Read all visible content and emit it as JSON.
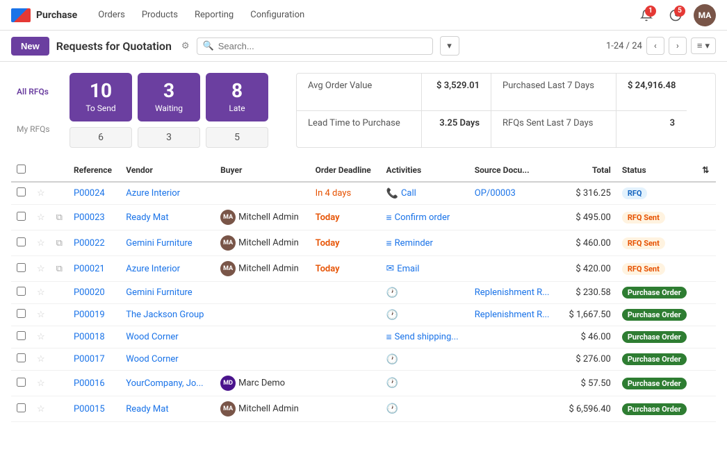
{
  "app": {
    "logo_text": "Purchase",
    "nav_items": [
      "Orders",
      "Products",
      "Reporting",
      "Configuration"
    ]
  },
  "topnav": {
    "notification_badge": "1",
    "activity_badge": "5",
    "avatar_initials": "MA"
  },
  "subheader": {
    "new_btn": "New",
    "title": "Requests for Quotation",
    "search_placeholder": "Search...",
    "pagination": "1-24 / 24"
  },
  "stats": {
    "all_rfqs_label": "All RFQs",
    "my_rfqs_label": "My RFQs",
    "cards": [
      {
        "num": "10",
        "label": "To Send"
      },
      {
        "num": "3",
        "label": "Waiting"
      },
      {
        "num": "8",
        "label": "Late"
      }
    ],
    "my_rfq_vals": [
      "6",
      "3",
      "5"
    ],
    "metrics": [
      {
        "label": "Avg Order Value",
        "value": "$ 3,529.01",
        "label2": "Purchased Last 7 Days",
        "value2": "$ 24,916.48"
      },
      {
        "label": "Lead Time to Purchase",
        "value": "3.25 Days",
        "label2": "RFQs Sent Last 7 Days",
        "value2": "3"
      }
    ]
  },
  "table": {
    "columns": [
      "",
      "",
      "",
      "Reference",
      "Vendor",
      "Buyer",
      "Order Deadline",
      "Activities",
      "Source Docu...",
      "Total",
      "Status",
      ""
    ],
    "rows": [
      {
        "id": "P00024",
        "vendor": "Azure Interior",
        "buyer": "",
        "deadline": "In 4 days",
        "deadline_class": "days",
        "activities": "Call",
        "activity_icon": "📞",
        "source": "OP/00003",
        "total": "$ 316.25",
        "status": "RFQ",
        "status_class": "rfq",
        "has_avatar": false,
        "has_copy": false
      },
      {
        "id": "P00023",
        "vendor": "Ready Mat",
        "buyer": "Mitchell Admin",
        "deadline": "Today",
        "deadline_class": "today",
        "activities": "Confirm order",
        "activity_icon": "≡",
        "source": "",
        "total": "$ 495.00",
        "status": "RFQ Sent",
        "status_class": "rfq-sent",
        "has_avatar": true,
        "has_copy": true
      },
      {
        "id": "P00022",
        "vendor": "Gemini Furniture",
        "buyer": "Mitchell Admin",
        "deadline": "Today",
        "deadline_class": "today",
        "activities": "Reminder",
        "activity_icon": "≡",
        "source": "",
        "total": "$ 460.00",
        "status": "RFQ Sent",
        "status_class": "rfq-sent",
        "has_avatar": true,
        "has_copy": true
      },
      {
        "id": "P00021",
        "vendor": "Azure Interior",
        "buyer": "Mitchell Admin",
        "deadline": "Today",
        "deadline_class": "today",
        "activities": "Email",
        "activity_icon": "✉",
        "source": "",
        "total": "$ 420.00",
        "status": "RFQ Sent",
        "status_class": "rfq-sent",
        "has_avatar": true,
        "has_copy": true
      },
      {
        "id": "P00020",
        "vendor": "Gemini Furniture",
        "buyer": "",
        "deadline": "",
        "deadline_class": "",
        "activities": "",
        "activity_icon": "🕐",
        "source": "Replenishment R...",
        "total": "$ 230.58",
        "status": "Purchase Order",
        "status_class": "po",
        "has_avatar": false,
        "has_copy": false
      },
      {
        "id": "P00019",
        "vendor": "The Jackson Group",
        "buyer": "",
        "deadline": "",
        "deadline_class": "",
        "activities": "",
        "activity_icon": "🕐",
        "source": "Replenishment R...",
        "total": "$ 1,667.50",
        "status": "Purchase Order",
        "status_class": "po",
        "has_avatar": false,
        "has_copy": false
      },
      {
        "id": "P00018",
        "vendor": "Wood Corner",
        "buyer": "",
        "deadline": "",
        "deadline_class": "",
        "activities": "Send shipping...",
        "activity_icon": "≡",
        "source": "",
        "total": "$ 46.00",
        "status": "Purchase Order",
        "status_class": "po",
        "has_avatar": false,
        "has_copy": false
      },
      {
        "id": "P00017",
        "vendor": "Wood Corner",
        "buyer": "",
        "deadline": "",
        "deadline_class": "",
        "activities": "",
        "activity_icon": "🕐",
        "source": "",
        "total": "$ 276.00",
        "status": "Purchase Order",
        "status_class": "po",
        "has_avatar": false,
        "has_copy": false
      },
      {
        "id": "P00016",
        "vendor": "YourCompany, Jo...",
        "buyer": "Marc Demo",
        "deadline": "",
        "deadline_class": "",
        "activities": "",
        "activity_icon": "🕐",
        "source": "",
        "total": "$ 57.50",
        "status": "Purchase Order",
        "status_class": "po",
        "has_avatar": true,
        "has_copy": false
      },
      {
        "id": "P00015",
        "vendor": "Ready Mat",
        "buyer": "Mitchell Admin",
        "deadline": "",
        "deadline_class": "",
        "activities": "",
        "activity_icon": "🕐",
        "source": "",
        "total": "$ 6,596.40",
        "status": "Purchase Order",
        "status_class": "po",
        "has_avatar": true,
        "has_copy": false
      }
    ]
  }
}
